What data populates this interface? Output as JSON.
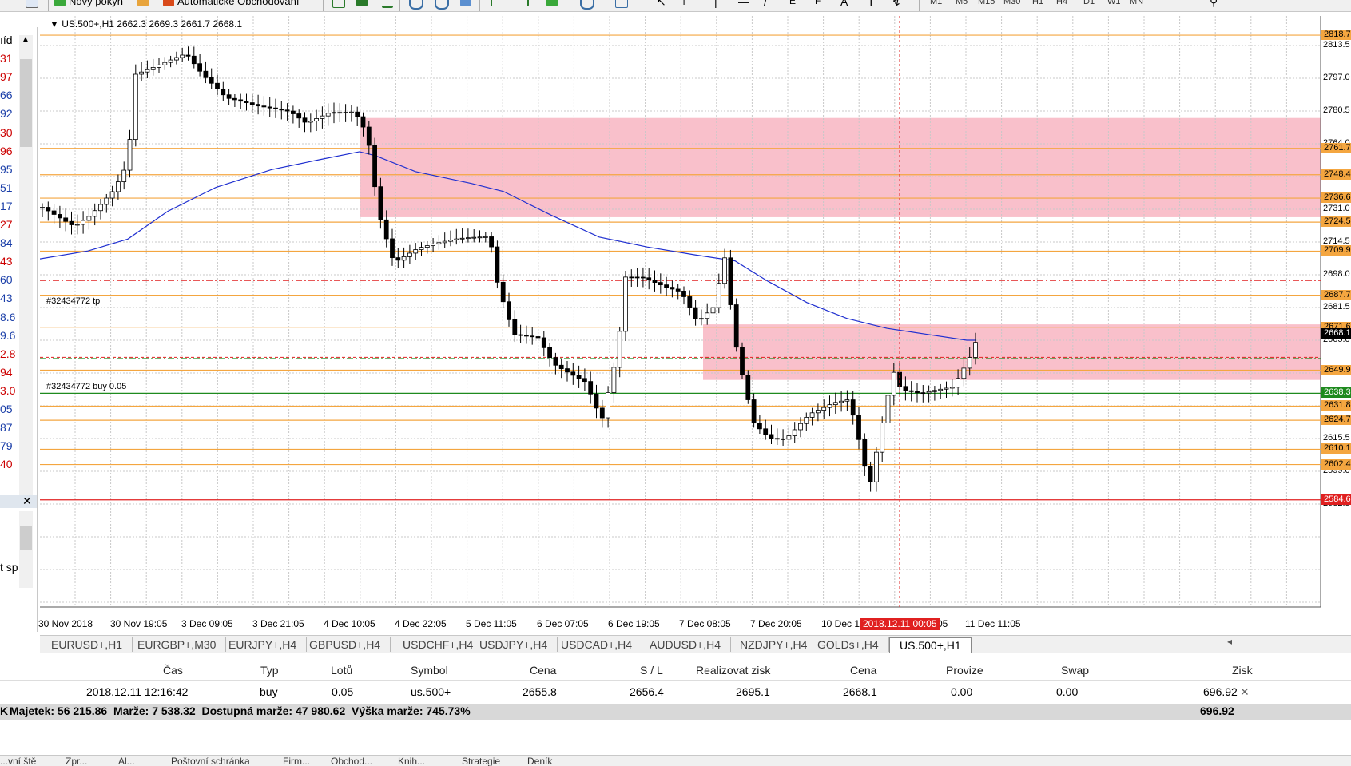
{
  "toolbar": {
    "new_order": "Nový pokyn",
    "auto_trading": "Automatické Obchodování",
    "timeframes": [
      "M1",
      "M5",
      "M15",
      "M30",
      "H1",
      "H4",
      "D1",
      "W1",
      "MN"
    ]
  },
  "navigator": {
    "numbers": [
      "ıíd",
      "31",
      "97",
      "66",
      "92",
      "30",
      "96",
      "95",
      "51",
      "17",
      "27",
      "84",
      "43",
      "60",
      "43",
      "8.6",
      "9.6",
      "2.8",
      "94",
      "3.0",
      "05",
      "87",
      "79",
      "40"
    ],
    "colors": [
      "#000000",
      "#cc0000",
      "#cc0000",
      "#1a3ea8",
      "#1a3ea8",
      "#cc0000",
      "#cc0000",
      "#1a3ea8",
      "#1a3ea8",
      "#1a3ea8",
      "#cc0000",
      "#1a3ea8",
      "#cc0000",
      "#1a3ea8",
      "#1a3ea8",
      "#1a3ea8",
      "#1a3ea8",
      "#cc0000",
      "#cc0000",
      "#cc0000",
      "#1a3ea8",
      "#1a3ea8",
      "#1a3ea8",
      "#cc0000"
    ],
    "lower_label": "t sp"
  },
  "chart": {
    "header": "US.500+,H1  2662.3 2669.3 2661.7 2668.1",
    "tp_label": "#32434772 tp",
    "buy_label": "#32434772 buy 0.05",
    "cursor_time": "2018.12.11 00:05",
    "price_axis": [
      "2813.5",
      "2797.0",
      "2780.5",
      "2764.0",
      "2747.5",
      "2731.0",
      "2714.5",
      "2698.0",
      "2681.5",
      "2665.0",
      "2648.5",
      "2632.0",
      "2615.5",
      "2599.0",
      "2582.5"
    ],
    "levels": [
      {
        "price": "2818.7",
        "color": "#f4a640"
      },
      {
        "price": "2761.7",
        "color": "#f4a640"
      },
      {
        "price": "2748.4",
        "color": "#f4a640"
      },
      {
        "price": "2736.6",
        "color": "#f4a640"
      },
      {
        "price": "2724.5",
        "color": "#f4a640"
      },
      {
        "price": "2709.9",
        "color": "#f4a640"
      },
      {
        "price": "2687.7",
        "color": "#f4a640"
      },
      {
        "price": "2671.6",
        "color": "#f4a640"
      },
      {
        "price": "2668.1",
        "color": "#000000"
      },
      {
        "price": "2649.9",
        "color": "#f4a640"
      },
      {
        "price": "2638.3",
        "color": "#1e8a1e"
      },
      {
        "price": "2631.8",
        "color": "#f4a640"
      },
      {
        "price": "2624.7",
        "color": "#f4a640"
      },
      {
        "price": "2610.1",
        "color": "#f4a640"
      },
      {
        "price": "2602.4",
        "color": "#f4a640"
      },
      {
        "price": "2584.6",
        "color": "#e02020"
      }
    ],
    "time_labels": [
      "30 Nov 2018",
      "30 Nov 19:05",
      "3 Dec 09:05",
      "3 Dec 21:05",
      "4 Dec 10:05",
      "4 Dec 22:05",
      "5 Dec 11:05",
      "6 Dec 07:05",
      "6 Dec 19:05",
      "7 Dec 08:05",
      "7 Dec 20:05",
      "10 Dec 1",
      "05",
      "11 Dec 11:05"
    ]
  },
  "tabs": [
    "EURUSD+,H1",
    "EURGBP+,M30",
    "EURJPY+,H4",
    "GBPUSD+,H4",
    "USDCHF+,H4",
    "USDJPY+,H4",
    "USDCAD+,H4",
    "AUDUSD+,H4",
    "NZDJPY+,H4",
    "GOLDs+,H4",
    "US.500+,H1"
  ],
  "active_tab": "US.500+,H1",
  "terminal": {
    "headers": [
      "Čas",
      "Typ",
      "Lotů",
      "Symbol",
      "Cena",
      "S / L",
      "Realizovat zisk",
      "Cena",
      "Provize",
      "Swap",
      "Zisk"
    ],
    "row": [
      "2018.12.11 12:16:42",
      "buy",
      "0.05",
      "us.500+",
      "2655.8",
      "2656.4",
      "2695.1",
      "2668.1",
      "0.00",
      "0.00",
      "696.92"
    ],
    "summary": "Majetek: 56 215.86  Marže: 7 538.32  Dostupná marže: 47 980.62  Výška marže: 745.73%",
    "summary_total": "696.92",
    "bottom_tabs": [
      "...vní ště",
      "Zpr...",
      "Al...",
      "Poštovní schránka",
      "Firm...",
      "Obchod...",
      "Knih...",
      "Strategie",
      "Deník"
    ]
  }
}
